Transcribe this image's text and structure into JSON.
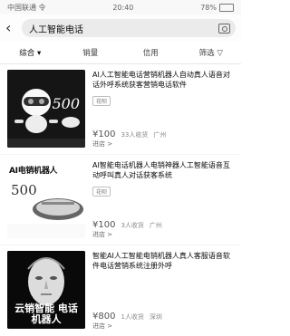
{
  "status_bar": {
    "carrier": "中国联通 令",
    "time": "20:40",
    "battery": "78%"
  },
  "search": {
    "query": "人工智能电话"
  },
  "filters": [
    {
      "label": "综合 ▾"
    },
    {
      "label": "销量"
    },
    {
      "label": "信用"
    },
    {
      "label": "筛选 ▽"
    }
  ],
  "items": [
    {
      "title": "AI人工智能电话营销机器人自动真人语音对话外呼系统获客营销电话软件",
      "tag": "花呗",
      "price": "¥100",
      "sales": "33人收货",
      "location": "广州",
      "shop": "进店 >",
      "thumb_text": "500"
    },
    {
      "title": "AI智能电话机器人电销神器人工智能语音互动呼叫真人对话获客系统",
      "tag": "花呗",
      "price": "¥100",
      "sales": "3人收货",
      "location": "广州",
      "shop": "进店 >",
      "thumb_badge": "AI电销机器人",
      "thumb_text": "500"
    },
    {
      "title": "智能AI人工智能电销机器人真人客服语音软件电话营销系统注册外呼",
      "tag": "",
      "price": "¥800",
      "sales": "1人收货",
      "location": "深圳",
      "shop": "进店 >",
      "thumb_text": "云销智能 电话机器人"
    }
  ]
}
